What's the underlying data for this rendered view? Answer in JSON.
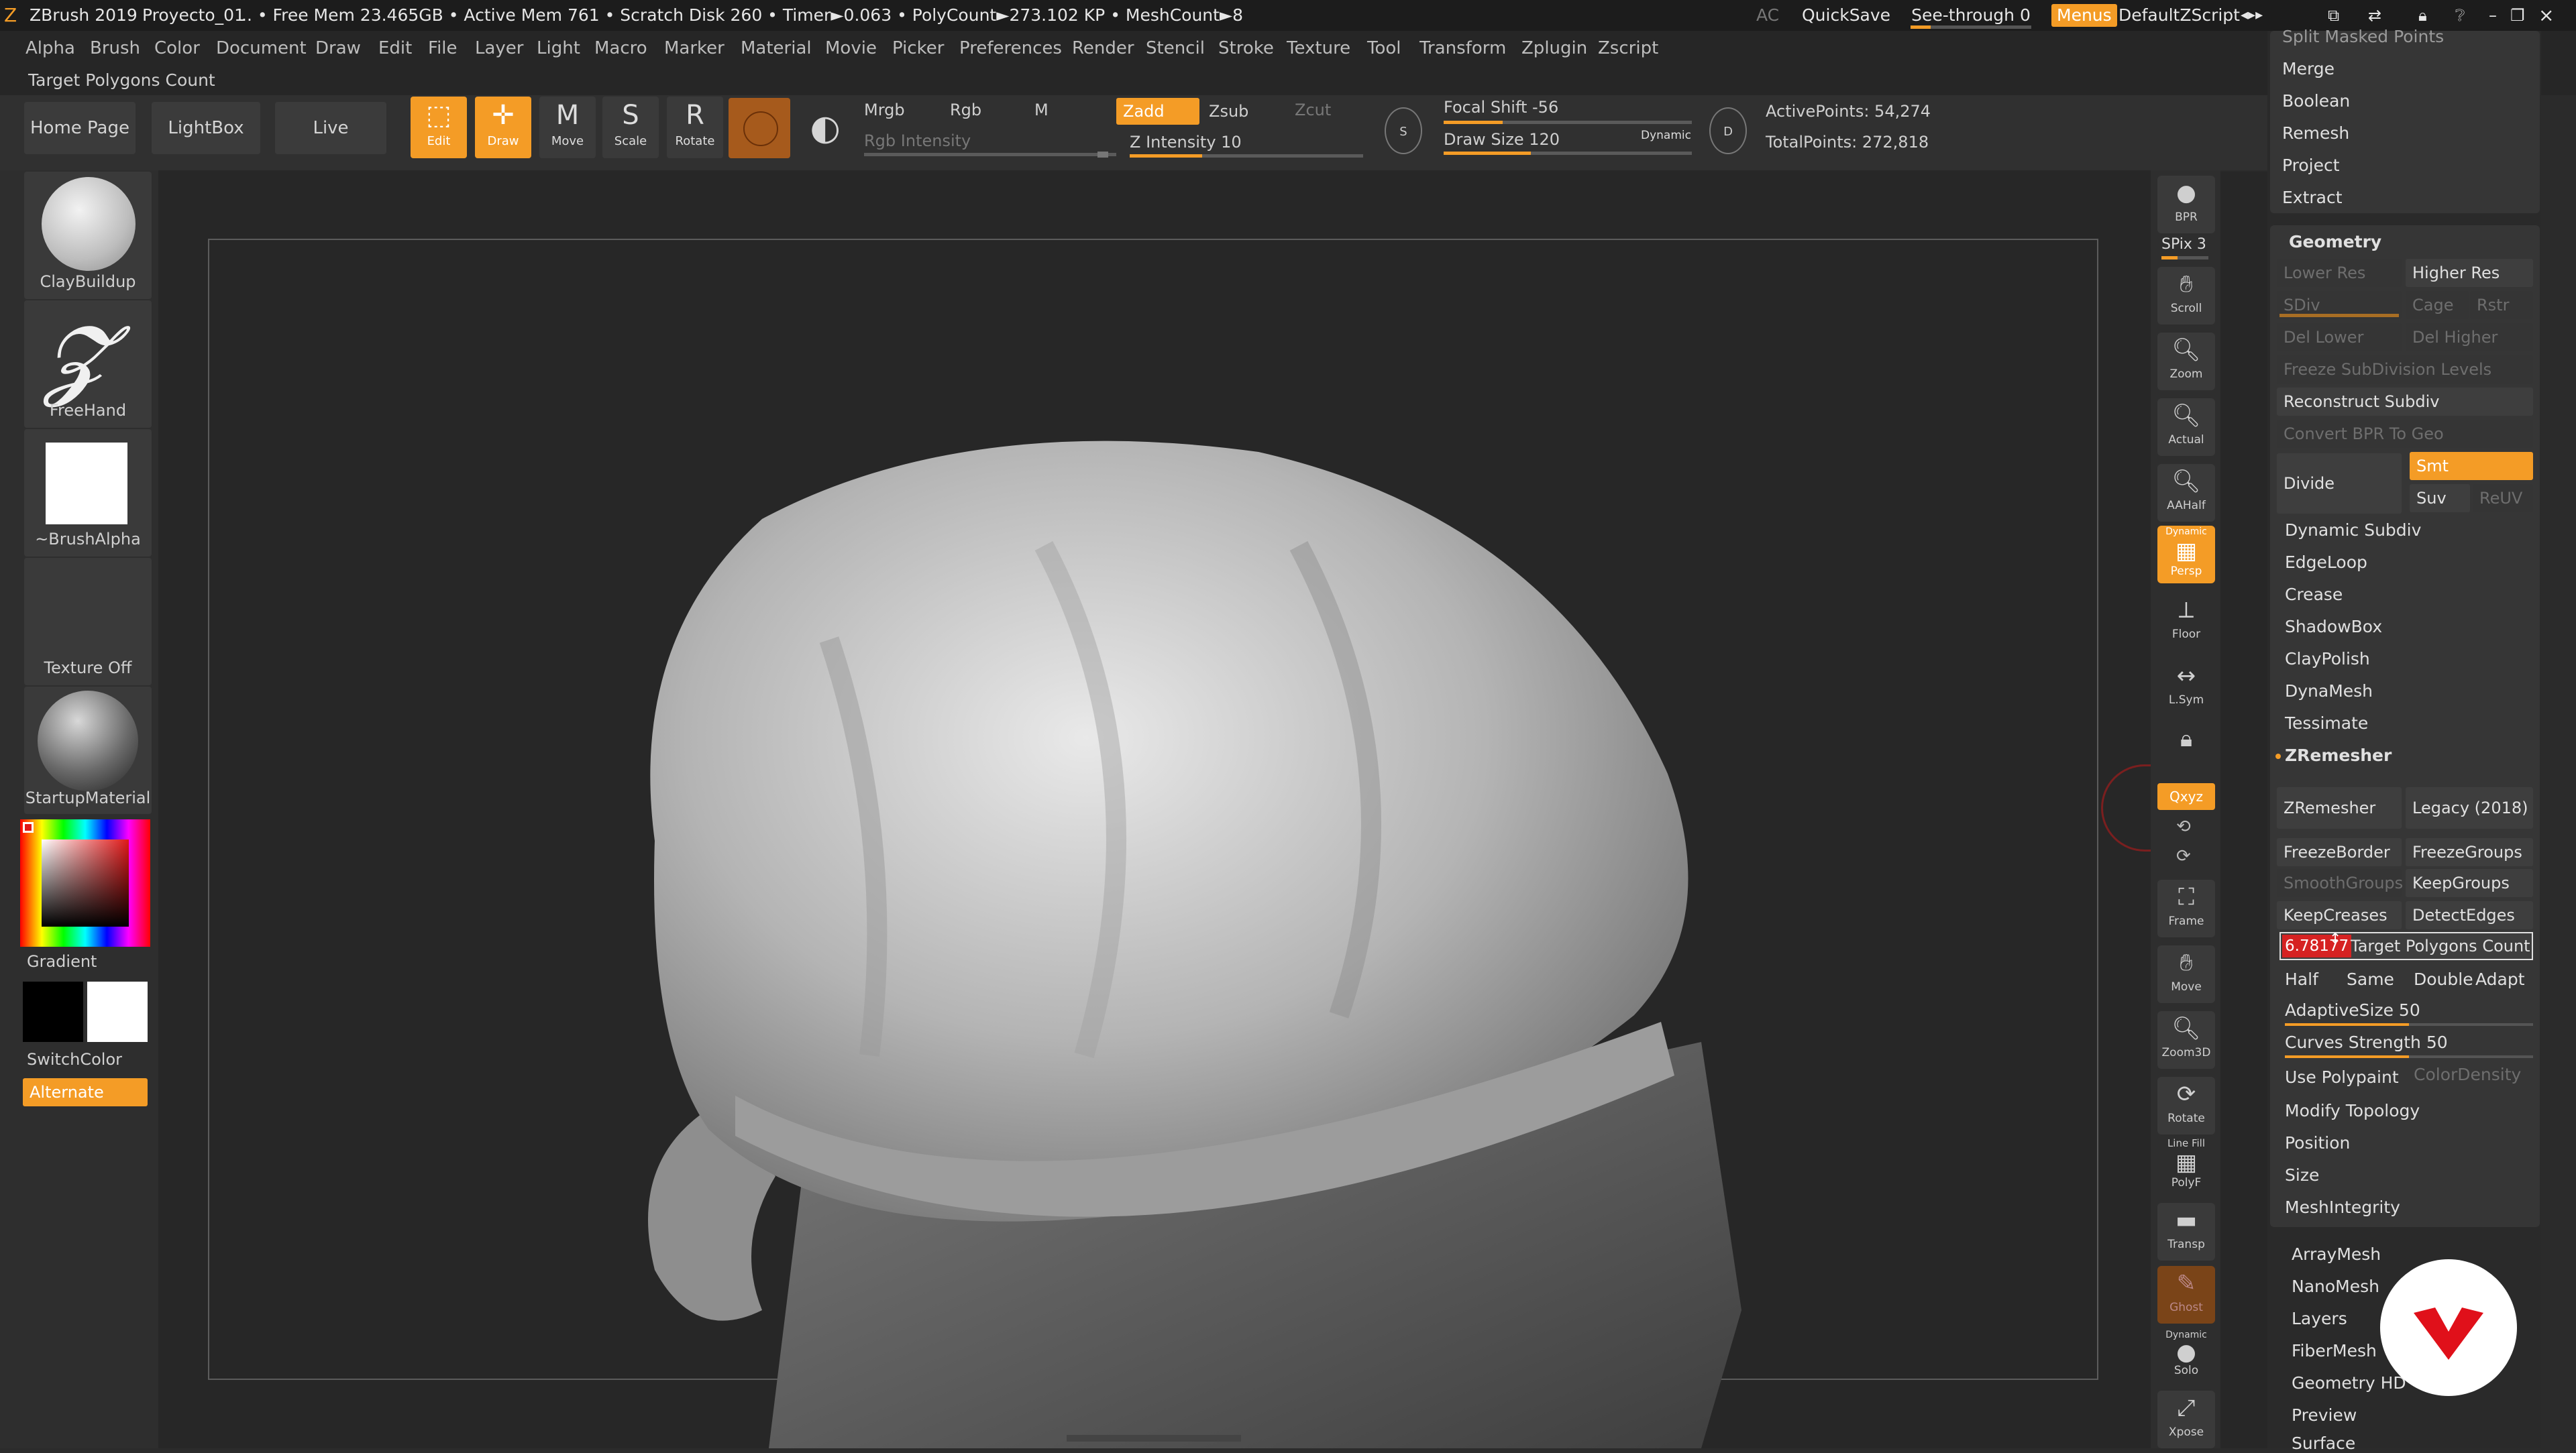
{
  "titlebar": {
    "app": "ZBrush 2019",
    "project": "Proyecto_01",
    "stats": ".. • Free Mem 23.465GB • Active Mem 761 • Scratch Disk 260 • Timer►0.063 • PolyCount►273.102 KP  • MeshCount►8",
    "ac": "AC",
    "quicksave": "QuickSave",
    "seethrough": "See-through  0",
    "menus": "Menus",
    "script": "DefaultZScript"
  },
  "menubar": {
    "items": [
      "Alpha",
      "Brush",
      "Color",
      "Document",
      "Draw",
      "Edit",
      "File",
      "Layer",
      "Light",
      "Macro",
      "Marker",
      "Material",
      "Movie",
      "Picker",
      "Preferences",
      "Render",
      "Stencil",
      "Stroke",
      "Texture",
      "Tool",
      "Transform",
      "Zplugin",
      "Zscript"
    ]
  },
  "tooltip": "Target Polygons Count",
  "toolbar": {
    "home": "Home Page",
    "lightbox": "LightBox",
    "liveboolean": "Live Boolean",
    "edit": "Edit",
    "draw": "Draw",
    "move": "Move",
    "scale": "Scale",
    "rotate": "Rotate",
    "mrgb": "Mrgb",
    "rgb": "Rgb",
    "m": "M",
    "zadd": "Zadd",
    "zsub": "Zsub",
    "zcut": "Zcut",
    "rgb_intensity": "Rgb Intensity",
    "z_intensity": "Z Intensity 10",
    "focal_shift": "Focal Shift -56",
    "draw_size": "Draw Size 120",
    "dynamic": "Dynamic",
    "active_points": "ActivePoints: 54,274",
    "total_points": "TotalPoints: 272,818"
  },
  "leftpanel": {
    "brush1": "ClayBuildup",
    "brush2": "FreeHand",
    "alpha": "~BrushAlpha",
    "texture": "Texture Off",
    "material": "StartupMaterial",
    "gradient": "Gradient",
    "switchcolor": "SwitchColor",
    "alternate": "Alternate"
  },
  "shelf": {
    "bpr": "BPR",
    "spix": "SPix 3",
    "scroll": "Scroll",
    "zoom": "Zoom",
    "actual": "Actual",
    "aahalf": "AAHalf",
    "dynamic_persp": "Dynamic",
    "persp": "Persp",
    "floor": "Floor",
    "lsym": "L.Sym",
    "xyz": "Qxyz",
    "frame": "Frame",
    "move": "Move",
    "zoom3d": "Zoom3D",
    "rotate": "Rotate",
    "linefill": "Line Fill",
    "polyf": "PolyF",
    "transp": "Transp",
    "ghost": "Ghost",
    "dynamic_solo": "Dynamic",
    "solo": "Solo",
    "xpose": "Xpose"
  },
  "tray": {
    "split": "Split Masked Points",
    "merge": "Merge",
    "boolean": "Boolean",
    "remesh": "Remesh",
    "project": "Project",
    "extract": "Extract",
    "geometry": "Geometry",
    "lower_res": "Lower Res",
    "higher_res": "Higher Res",
    "sdiv": "SDiv",
    "cage": "Cage",
    "rstr": "Rstr",
    "del_lower": "Del Lower",
    "del_higher": "Del Higher",
    "freeze_subdiv": "Freeze SubDivision Levels",
    "reconstruct": "Reconstruct Subdiv",
    "convert_bpr": "Convert BPR To Geo",
    "divide": "Divide",
    "smt": "Smt",
    "suv": "Suv",
    "reuv": "ReUV",
    "dynamic_subdiv": "Dynamic Subdiv",
    "edgeloop": "EdgeLoop",
    "crease": "Crease",
    "shadowbox": "ShadowBox",
    "claypolish": "ClayPolish",
    "dynamesh": "DynaMesh",
    "tessimate": "Tessimate",
    "zremesher_header": "ZRemesher",
    "zremesher_btn": "ZRemesher",
    "legacy": "Legacy (2018)",
    "freezeborder": "FreezeBorder",
    "freezegroups": "FreezeGroups",
    "smoothgroups": "SmoothGroups",
    "keepgroups": "KeepGroups",
    "keepcreases": "KeepCreases",
    "detectedges": "DetectEdges",
    "target_value": "6.78177",
    "target_label": "Target Polygons Count",
    "half": "Half",
    "same": "Same",
    "double": "Double",
    "adapt": "Adapt",
    "adaptive_size": "AdaptiveSize 50",
    "curves_strength": "Curves Strength 50",
    "use_polypaint": "Use Polypaint",
    "color_density": "ColorDensity",
    "modify_topology": "Modify Topology",
    "position": "Position",
    "size": "Size",
    "meshintegrity": "MeshIntegrity",
    "arraymesh": "ArrayMesh",
    "nanomesh": "NanoMesh",
    "layers": "Layers",
    "fibermesh": "FiberMesh",
    "geometry_hd": "Geometry HD",
    "preview": "Preview",
    "surface": "Surface"
  },
  "colors": {
    "accent": "#f49c26",
    "value_field": "#d62222",
    "brand": "#e0101a"
  }
}
